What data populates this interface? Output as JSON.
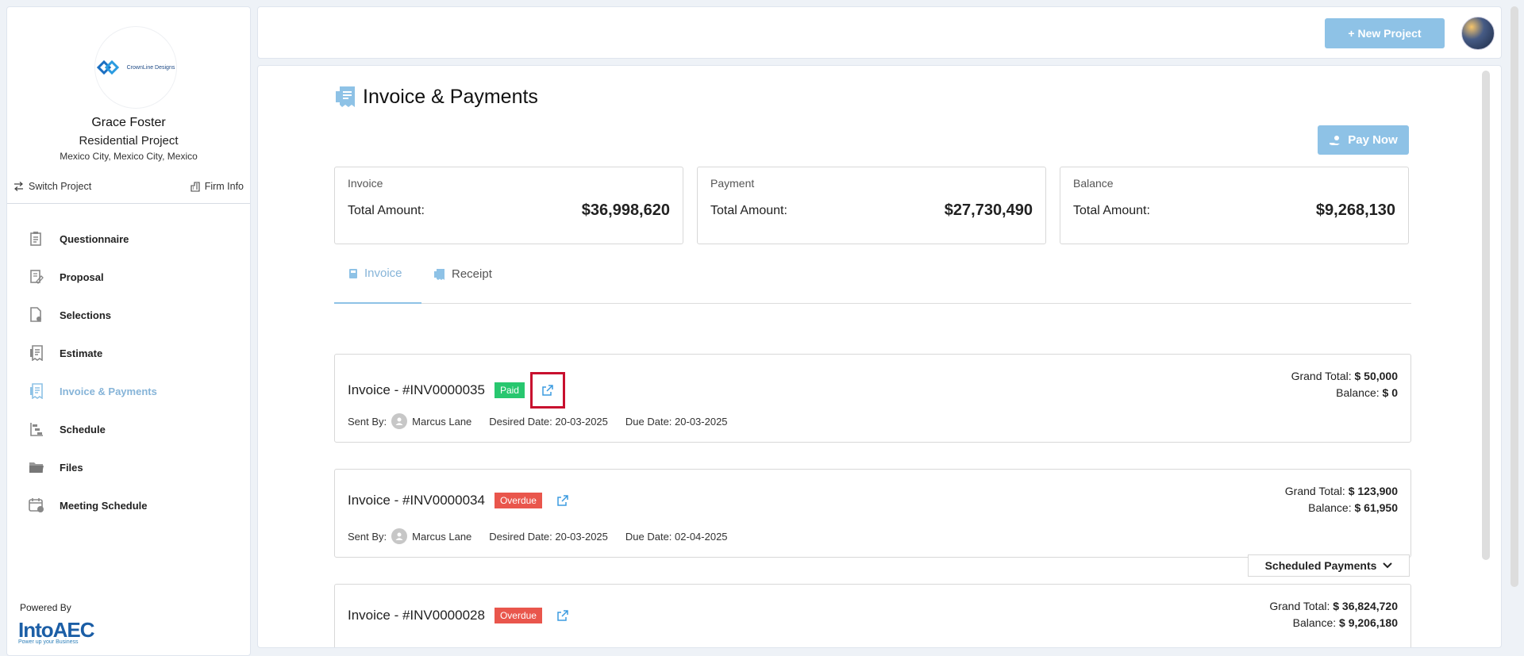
{
  "sidebar": {
    "logo_text": "CrownLine Designs",
    "client_name": "Grace Foster",
    "project_type": "Residential Project",
    "location": "Mexico City, Mexico City, Mexico",
    "switch_project": "Switch Project",
    "firm_info": "Firm Info",
    "nav": [
      {
        "label": "Questionnaire",
        "icon": "clipboard-icon"
      },
      {
        "label": "Proposal",
        "icon": "edit-document-icon"
      },
      {
        "label": "Selections",
        "icon": "document-gear-icon"
      },
      {
        "label": "Estimate",
        "icon": "receipt-icon"
      },
      {
        "label": "Invoice & Payments",
        "icon": "receipt-icon",
        "active": true
      },
      {
        "label": "Schedule",
        "icon": "gantt-icon"
      },
      {
        "label": "Files",
        "icon": "folder-icon"
      },
      {
        "label": "Meeting Schedule",
        "icon": "calendar-clock-icon"
      }
    ],
    "powered_by": "Powered By",
    "brand": "IntoAEC",
    "brand_tagline": "Power up your Business"
  },
  "topbar": {
    "new_project": "+ New Project"
  },
  "page": {
    "title": "Invoice & Payments",
    "pay_now": "Pay Now"
  },
  "summary": [
    {
      "label": "Invoice",
      "total_label": "Total Amount:",
      "amount": "$36,998,620"
    },
    {
      "label": "Payment",
      "total_label": "Total Amount:",
      "amount": "$27,730,490"
    },
    {
      "label": "Balance",
      "total_label": "Total Amount:",
      "amount": "$9,268,130"
    }
  ],
  "tabs": {
    "invoice": "Invoice",
    "receipt": "Receipt"
  },
  "invoices": [
    {
      "title": "Invoice - #INV0000035",
      "status": "Paid",
      "sent_by_label": "Sent By:",
      "sender": "Marcus Lane",
      "desired_date": "Desired Date: 20-03-2025",
      "due_date": "Due Date: 20-03-2025",
      "grand_total_label": "Grand Total:",
      "grand_total": "$ 50,000",
      "balance_label": "Balance:",
      "balance": "$ 0"
    },
    {
      "title": "Invoice - #INV0000034",
      "status": "Overdue",
      "sent_by_label": "Sent By:",
      "sender": "Marcus Lane",
      "desired_date": "Desired Date: 20-03-2025",
      "due_date": "Due Date: 02-04-2025",
      "grand_total_label": "Grand Total:",
      "grand_total": "$ 123,900",
      "balance_label": "Balance:",
      "balance": "$ 61,950",
      "scheduled_payments": "Scheduled Payments"
    },
    {
      "title": "Invoice - #INV0000028",
      "status": "Overdue",
      "grand_total_label": "Grand Total:",
      "grand_total": "$ 36,824,720",
      "balance_label": "Balance:",
      "balance": "$ 9,206,180"
    }
  ],
  "colors": {
    "accent": "#8ec2e6",
    "paid": "#28c76f",
    "overdue": "#e9564c",
    "highlight": "#c8102e"
  }
}
